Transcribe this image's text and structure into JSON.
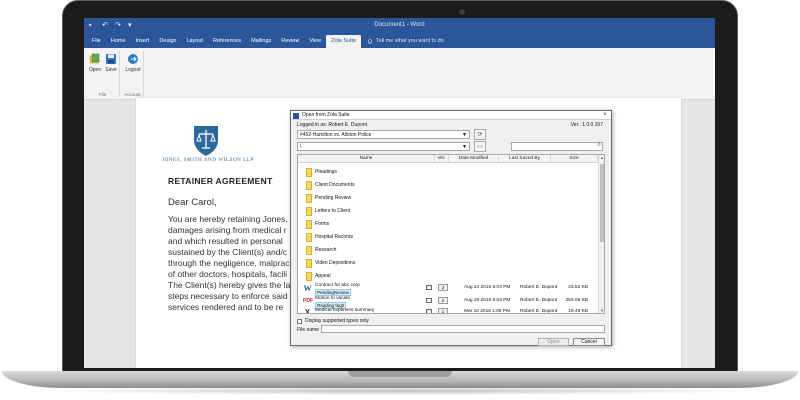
{
  "app": {
    "document_title": "Document1 - Word",
    "qat_icons": [
      "save-icon",
      "undo-icon",
      "redo-icon",
      "customize-icon"
    ]
  },
  "ribbon": {
    "tabs": [
      "File",
      "Home",
      "Insert",
      "Design",
      "Layout",
      "References",
      "Mailings",
      "Review",
      "View",
      "Zola Suite"
    ],
    "active_tab": "Zola Suite",
    "tell_me": "Tell me what you want to do",
    "groups": {
      "file": {
        "label": "File",
        "buttons": [
          {
            "label": "Open",
            "icon": "open-icon"
          },
          {
            "label": "Save",
            "icon": "save-icon"
          }
        ]
      },
      "account": {
        "label": "Account",
        "buttons": [
          {
            "label": "Logout",
            "icon": "logout-icon"
          }
        ]
      }
    }
  },
  "document": {
    "firm_name": "JONES, SMITH AND WILSON LLP",
    "heading": "RETAINER AGREEMENT",
    "salutation": "Dear Carol,",
    "body": "You are hereby retaining Jones,\ndamages arising from medical r\nand which resulted in personal\nsustained by the Client(s) and/c\nthrough the negligence, malprac\nof other doctors, hospitals, facili\nThe Client(s) hereby gives the la\nsteps necessary to enforce said\nservices rendered and to be re"
  },
  "dialog": {
    "title": "Open from Zola Suite",
    "logged_in": "Logged in as: Robert E. Dupont",
    "version": "Ver.: 1.0.0.157",
    "matter": "#452-Hamilton vs. Allston Police",
    "path": "\\",
    "columns": [
      "Name",
      "Ver.",
      "Date Modified",
      "Last Saved By",
      "Size"
    ],
    "folders": [
      "Pleadings",
      "Client Documents",
      "Pending Review",
      "Letters to Client",
      "Forms",
      "Hospital Records",
      "Research",
      "Video Depositions",
      "Appeal"
    ],
    "files": [
      {
        "name": "Contract for abc corp",
        "tag": "PendingReview",
        "icon": "word-file-icon",
        "version": "2",
        "date": "Aug 24 2016 6:04 PM",
        "saved_by": "Robert E. Dupont",
        "size": "23.52 KB"
      },
      {
        "name": "Motion to vacate",
        "tag": "Reading  tag2",
        "icon": "pdf-file-icon",
        "version": "2",
        "date": "Aug 29 2016 6:03 PM",
        "saved_by": "Robert E. Dupont",
        "size": "263.09 KB"
      },
      {
        "name": "Medical expenses summary",
        "tag": "",
        "icon": "excel-file-icon",
        "version": "1",
        "date": "Mar 10 2016 1:05 PM",
        "saved_by": "Robert E. Dupont",
        "size": "19.49 KB"
      }
    ],
    "display_supported": "Display supported types only",
    "file_name_label": "File name",
    "file_name_value": "",
    "open_label": "Open",
    "cancel_label": "Cancel"
  }
}
